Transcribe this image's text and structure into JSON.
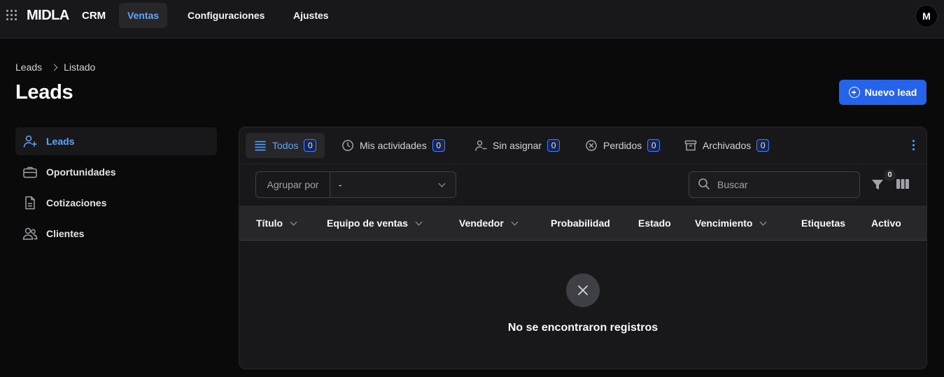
{
  "topbar": {
    "brand": "MIDLA",
    "product": "CRM",
    "nav": [
      {
        "label": "Ventas",
        "active": true
      },
      {
        "label": "Configuraciones",
        "active": false
      },
      {
        "label": "Ajustes",
        "active": false
      }
    ],
    "avatar_initial": "M"
  },
  "breadcrumb": [
    "Leads",
    "Listado"
  ],
  "page": {
    "title": "Leads",
    "new_button_label": "Nuevo lead"
  },
  "sidebar": {
    "items": [
      {
        "label": "Leads",
        "icon": "user-plus-icon",
        "active": true
      },
      {
        "label": "Oportunidades",
        "icon": "briefcase-icon",
        "active": false
      },
      {
        "label": "Cotizaciones",
        "icon": "document-icon",
        "active": false
      },
      {
        "label": "Clientes",
        "icon": "users-icon",
        "active": false
      }
    ]
  },
  "tabs": [
    {
      "label": "Todos",
      "count": "0",
      "icon": "list-icon",
      "active": true
    },
    {
      "label": "Mis actividades",
      "count": "0",
      "icon": "clock-icon",
      "active": false
    },
    {
      "label": "Sin asignar",
      "count": "0",
      "icon": "user-minus-icon",
      "active": false
    },
    {
      "label": "Perdidos",
      "count": "0",
      "icon": "x-circle-icon",
      "active": false
    },
    {
      "label": "Archivados",
      "count": "0",
      "icon": "archive-icon",
      "active": false
    }
  ],
  "toolbar": {
    "group_label": "Agrupar por",
    "group_value": "-",
    "search_placeholder": "Buscar",
    "filter_count": "0"
  },
  "table": {
    "columns": [
      {
        "label": "Título",
        "sortable": true
      },
      {
        "label": "Equipo de ventas",
        "sortable": true
      },
      {
        "label": "Vendedor",
        "sortable": true
      },
      {
        "label": "Probabilidad",
        "sortable": false
      },
      {
        "label": "Estado",
        "sortable": false
      },
      {
        "label": "Vencimiento",
        "sortable": true
      },
      {
        "label": "Etiquetas",
        "sortable": false
      },
      {
        "label": "Activo",
        "sortable": false
      }
    ],
    "empty_message": "No se encontraron registros"
  },
  "colors": {
    "accent": "#60a5fa",
    "primary_button": "#2563eb",
    "background": "#0a0a0b",
    "surface": "#18181b"
  }
}
